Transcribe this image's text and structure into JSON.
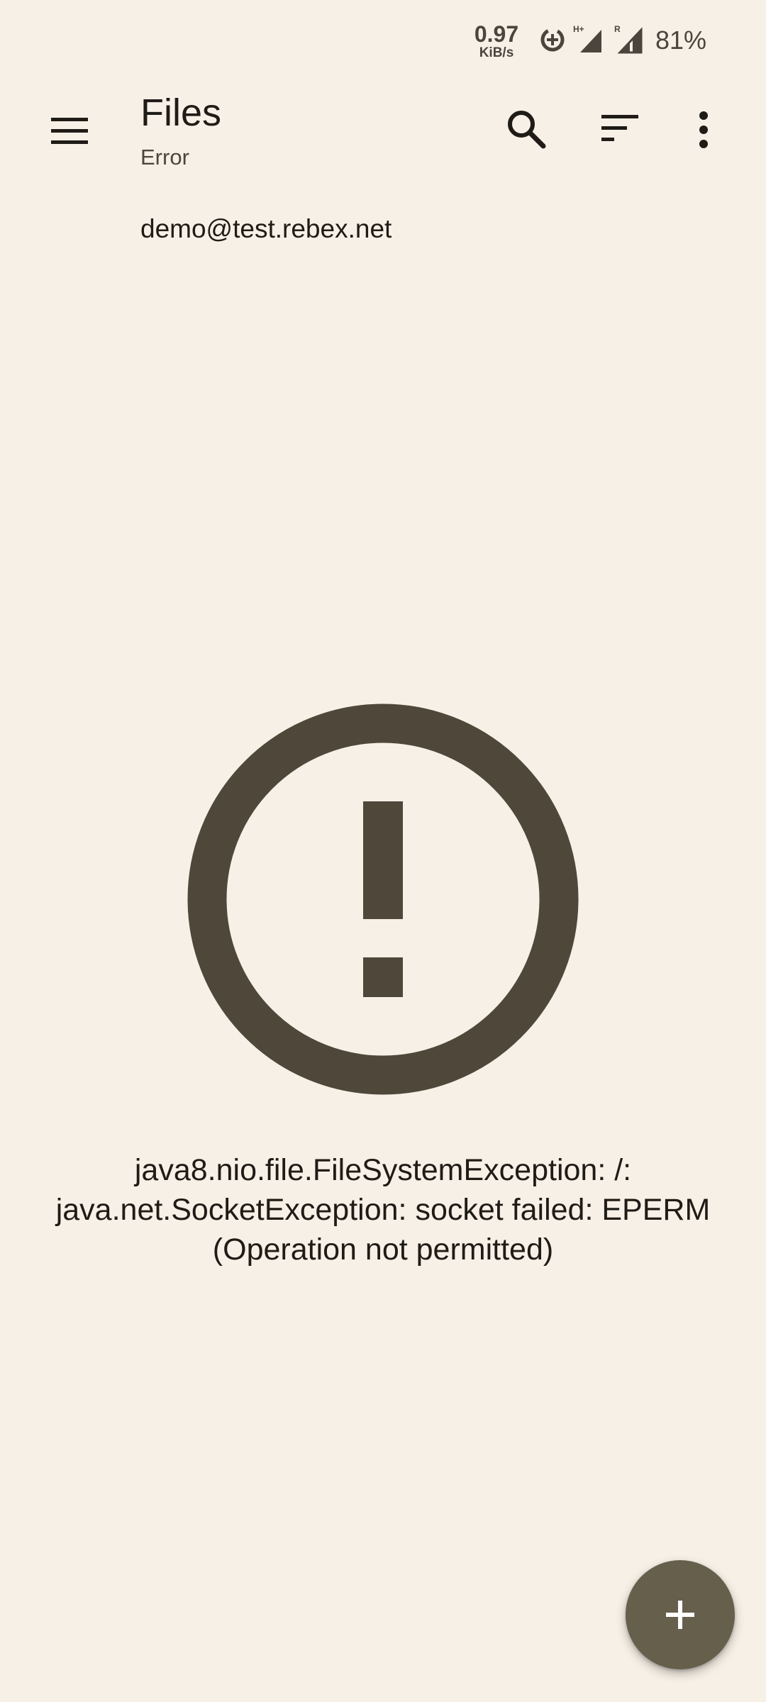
{
  "status_bar": {
    "net_speed_value": "0.97",
    "net_speed_unit": "KiB/s",
    "signal1_label": "H+",
    "signal2_label": "R",
    "battery": "81%"
  },
  "toolbar": {
    "title": "Files",
    "subtitle": "Error",
    "icons": [
      "menu-icon",
      "search-icon",
      "sort-icon",
      "more-vert-icon"
    ]
  },
  "breadcrumb": {
    "path": "demo@test.rebex.net"
  },
  "error": {
    "icon": "error-outline-icon",
    "message_line1": "java8.nio.file.FileSystemException: /:",
    "message_line2": "java.net.SocketException: socket failed: EPERM",
    "message_line3": "(Operation not permitted)"
  },
  "fab": {
    "icon": "add-icon"
  },
  "colors": {
    "background": "#f7f0e6",
    "icon": "#4f473a",
    "fab": "#665f4c",
    "text": "#1f1b16"
  }
}
